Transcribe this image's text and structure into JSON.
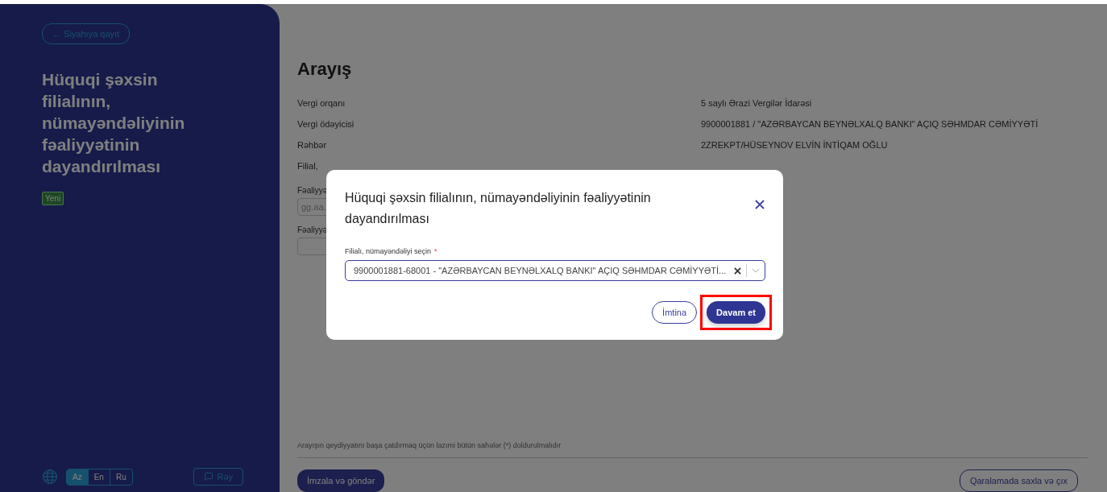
{
  "sidebar": {
    "back_link": "← Siyahıya qayıt",
    "title": "Hüquqi şəxsin filialının, nümayəndəliyinin fəaliyyətinin dayandırılması",
    "status_badge": "Yeni",
    "languages": [
      {
        "label": "Az",
        "selected": true
      },
      {
        "label": "En",
        "selected": false
      },
      {
        "label": "Ru",
        "selected": false
      }
    ],
    "feedback_button": "Rəy"
  },
  "main": {
    "heading": "Arayış",
    "details": [
      {
        "label": "Vergi orqanı",
        "value": "5 saylı Ərazi Vergilər İdarəsi"
      },
      {
        "label": "Vergi ödəyicisi",
        "value": "9900001881 / \"AZƏRBAYCAN BEYNƏLXALQ BANKI\" AÇIQ SƏHMDAR CƏMİYYƏTİ"
      },
      {
        "label": "Rəhbər",
        "value": "2ZREKPT/HÜSEYNOV ELVİN İNTİQAM OĞLU"
      },
      {
        "label": "Filial,"
      }
    ],
    "fields": [
      {
        "label": "Fəaliyyə",
        "placeholder": "gg.aa."
      },
      {
        "label": "Fəaliyyə"
      }
    ],
    "note": "Arayışın qeydiyyatını başa çatdırmaq üçün lazımi bütün sahələr (*) doldurulmalıdır",
    "sign_button": "İmzala və göndər",
    "draft_button": "Qaralamada saxla və çıx"
  },
  "modal": {
    "title": "Hüquqi şəxsin filialının, nümayəndəliyinin fəaliyyətinin dayandırılması",
    "select_label": "Filialı, nümayəndəliyi seçin",
    "required_mark": "*",
    "select_value": "9900001881-68001 - \"AZƏRBAYCAN BEYNƏLXALQ BANKI\" AÇIQ SƏHMDAR CƏMİYYƏTİ...",
    "cancel_button": "İmtina",
    "confirm_button": "Davam et",
    "confirm_highlighted": true
  }
}
